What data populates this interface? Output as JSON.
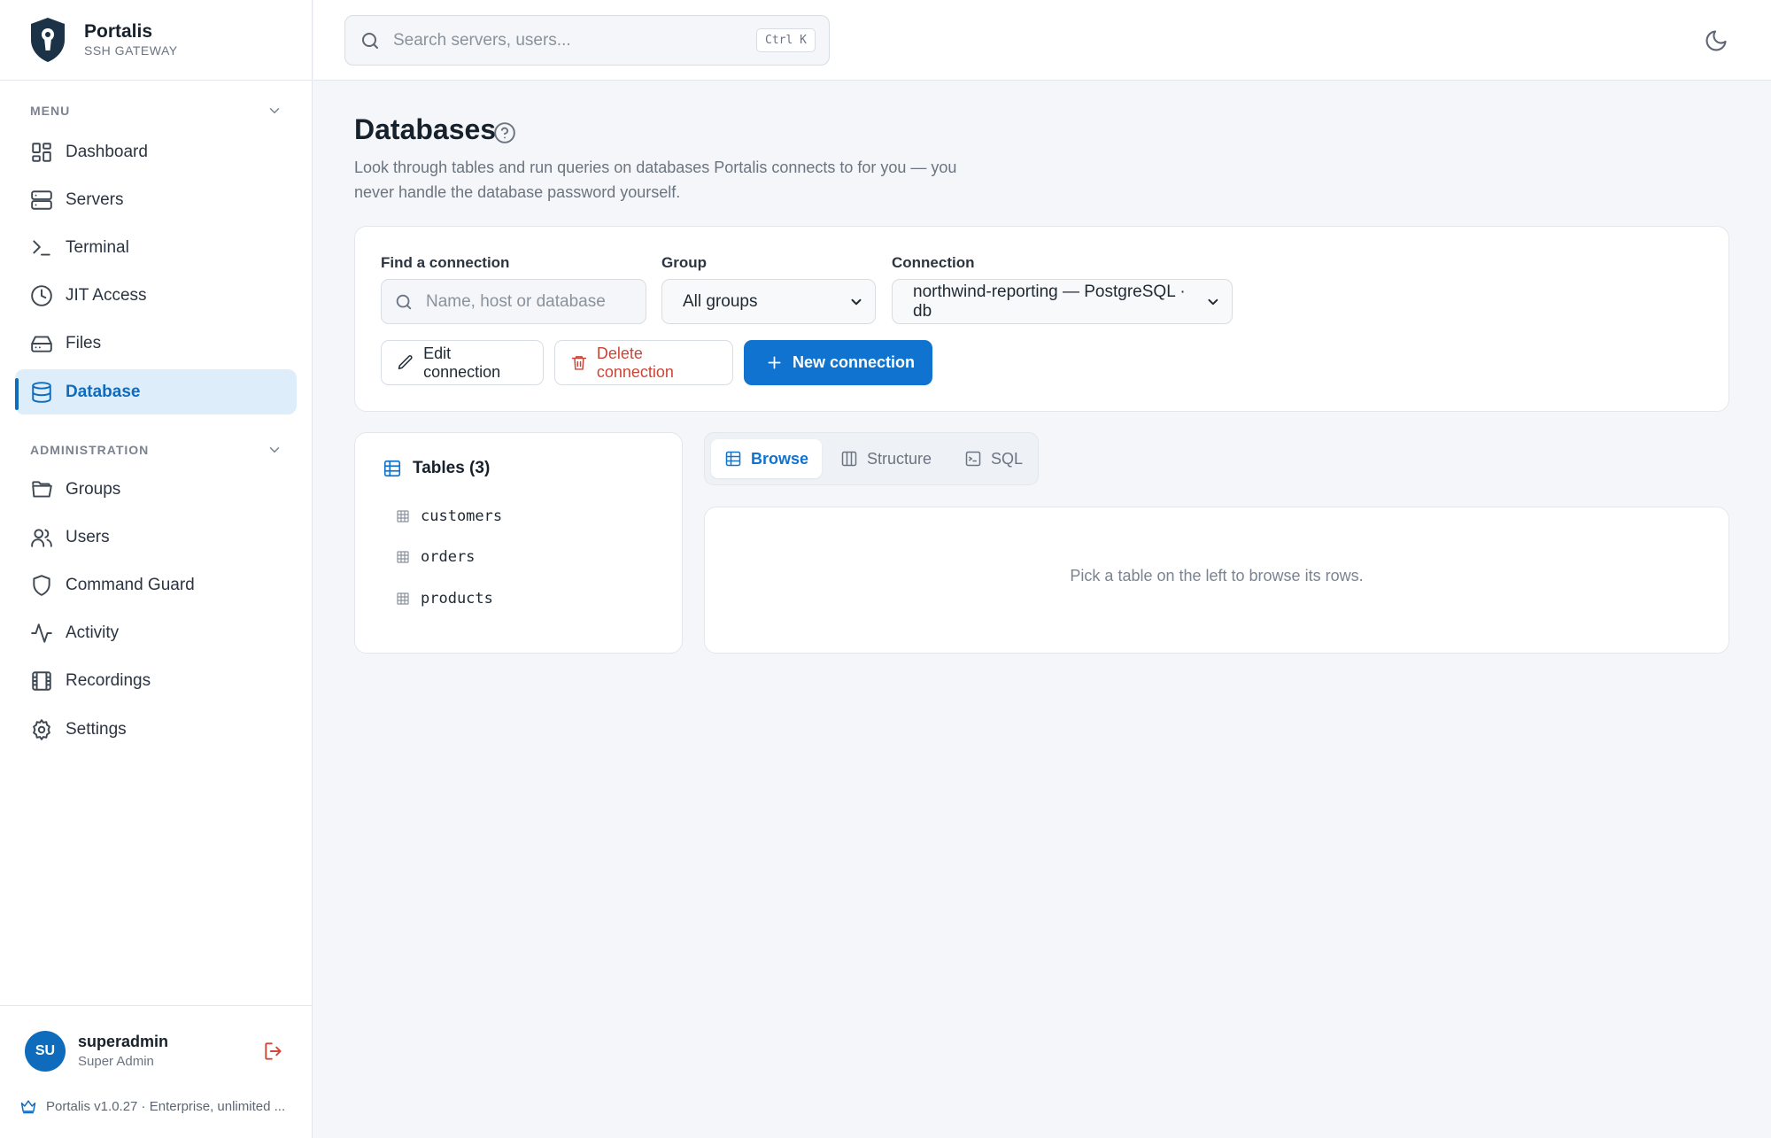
{
  "brand": {
    "name": "Portalis",
    "subtitle": "SSH GATEWAY"
  },
  "sidebar": {
    "menu_heading": "MENU",
    "menu_items": [
      {
        "label": "Dashboard",
        "icon": "dashboard-icon"
      },
      {
        "label": "Servers",
        "icon": "server-icon"
      },
      {
        "label": "Terminal",
        "icon": "terminal-icon"
      },
      {
        "label": "JIT Access",
        "icon": "clock-icon"
      },
      {
        "label": "Files",
        "icon": "hard-drive-icon"
      },
      {
        "label": "Database",
        "icon": "database-icon",
        "active": true
      }
    ],
    "admin_heading": "ADMINISTRATION",
    "admin_items": [
      {
        "label": "Groups",
        "icon": "folder-icon"
      },
      {
        "label": "Users",
        "icon": "users-icon"
      },
      {
        "label": "Command Guard",
        "icon": "shield-icon"
      },
      {
        "label": "Activity",
        "icon": "activity-icon"
      },
      {
        "label": "Recordings",
        "icon": "film-icon"
      },
      {
        "label": "Settings",
        "icon": "gear-icon"
      }
    ]
  },
  "user": {
    "initials": "SU",
    "name": "superadmin",
    "role": "Super Admin",
    "version": "Portalis v1.0.27 · Enterprise, unlimited ..."
  },
  "topbar": {
    "search_placeholder": "Search servers, users...",
    "shortcut": "Ctrl K"
  },
  "page": {
    "title": "Databases",
    "description": "Look through tables and run queries on databases Portalis connects to for you — you never handle the database password yourself."
  },
  "connection_panel": {
    "find_label": "Find a connection",
    "find_placeholder": "Name, host or database",
    "group_label": "Group",
    "group_value": "All groups",
    "connection_label": "Connection",
    "connection_value": "northwind-reporting — PostgreSQL · db",
    "edit_button": "Edit connection",
    "delete_button": "Delete connection",
    "new_button": "New connection"
  },
  "tables_panel": {
    "heading": "Tables (3)",
    "tables": [
      "customers",
      "orders",
      "products"
    ]
  },
  "tabs": [
    {
      "label": "Browse",
      "icon": "table-icon",
      "active": true
    },
    {
      "label": "Structure",
      "icon": "columns-icon"
    },
    {
      "label": "SQL",
      "icon": "terminal-square-icon"
    }
  ],
  "browse": {
    "empty_message": "Pick a table on the left to browse its rows."
  },
  "colors": {
    "accent": "#0f73cf",
    "danger": "#c8473a",
    "active_bg": "#deedfa"
  }
}
